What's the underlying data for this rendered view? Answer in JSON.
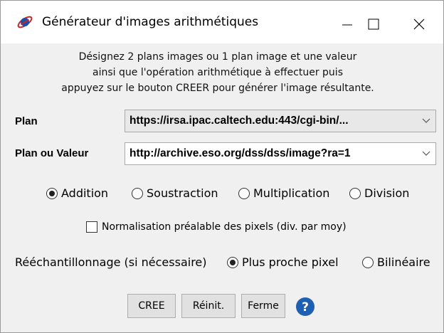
{
  "window": {
    "title": "Générateur d'images arithmétiques",
    "icon": "saturn-icon",
    "controls": [
      "minimize-icon",
      "maximize-icon",
      "close-icon"
    ]
  },
  "description": {
    "line1": "Désignez 2 plans images ou 1 plan image et une valeur",
    "line2": "ainsi que l'opération arithmétique à effectuer puis",
    "line3": "appuyez sur le bouton CREER pour générer l'image résultante."
  },
  "plan": {
    "label": "Plan",
    "value": "https://irsa.ipac.caltech.edu:443/cgi-bin/..."
  },
  "plan_or_value": {
    "label": "Plan ou Valeur",
    "value": "http://archive.eso.org/dss/dss/image?ra=1"
  },
  "operations": {
    "options": [
      "Addition",
      "Soustraction",
      "Multiplication",
      "Division"
    ],
    "selected": "Addition"
  },
  "normalisation": {
    "label": "Normalisation préalable des pixels (div. par moy)",
    "checked": false
  },
  "resampling": {
    "label": "Rééchantillonnage (si nécessaire)",
    "options": [
      "Plus proche pixel",
      "Bilinéaire"
    ],
    "selected": "Plus proche pixel"
  },
  "buttons": {
    "create": "CREE",
    "reset": "Réinit.",
    "close": "Ferme",
    "help_icon": "help-icon"
  },
  "colors": {
    "help_blue": "#1f5fb3",
    "icon_red": "#c0282d"
  }
}
